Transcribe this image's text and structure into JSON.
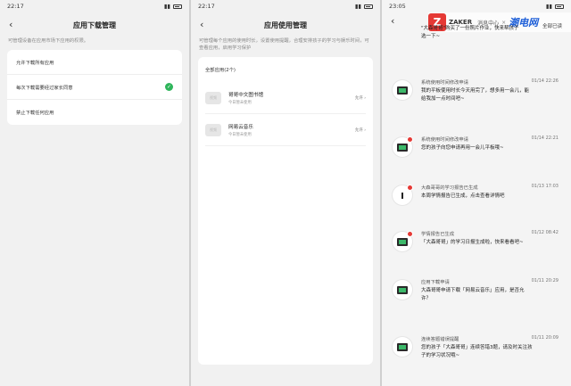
{
  "screen1": {
    "time": "22:17",
    "title": "应用下载管理",
    "hint": "可管理设备在应用市场下应用的权限。",
    "options": [
      {
        "label": "允许下载所有应用",
        "checked": false
      },
      {
        "label": "每次下载需要经过家长同意",
        "checked": true
      },
      {
        "label": "禁止下载任何应用",
        "checked": false
      }
    ]
  },
  "screen2": {
    "time": "22:17",
    "title": "应用使用管理",
    "hint": "可管理每个应用的使用时长，设置使用提醒，合理安排孩子的学习与娱乐时间，可查看应用，启用学习保护",
    "section": "全部应用(2个)",
    "apps": [
      {
        "icon_text": "视频",
        "name": "哥哥中文图书馆",
        "sub": "今日暂未使用",
        "right": "允许"
      },
      {
        "icon_text": "视频",
        "name": "网易云音乐",
        "sub": "今日暂未使用",
        "right": "允许"
      }
    ]
  },
  "screen3": {
    "time": "23:05",
    "read_all": "全部已读",
    "banner": {
      "logo": "Z",
      "brand": "ZAKER",
      "label": "消息中心",
      "sep": "×",
      "partner": "潮电网"
    },
    "top_message": "\"大森哥哥\"购买了一份照片作业，快来帮孩子\n选一下~",
    "messages": [
      {
        "title": "系统使用时间修改申请",
        "time": "01/14 22:26",
        "body": "我的平板使用时长今天用完了，想多用一会儿，能\n给我加一点时间吧~",
        "dot": false,
        "icon": "tablet"
      },
      {
        "title": "系统使用时间修改申请",
        "time": "01/14 22:21",
        "body": "您的孩子向您申请再用一会儿平板哦~",
        "dot": true,
        "icon": "tablet"
      },
      {
        "title": "大森哥哥的学习报告已生成",
        "time": "01/13 17:03",
        "body": "本周学情报告已生成，点击查看详情吧",
        "dot": true,
        "icon": "clock"
      },
      {
        "title": "学情报告已生成",
        "time": "01/12 08:42",
        "body": "「大森哥哥」的学习日报生成啦，快来看看吧~",
        "dot": true,
        "icon": "tablet"
      },
      {
        "title": "应用下载申请",
        "time": "01/11 20:29",
        "body": "大森哥哥申请下载「网易云音乐」应用，是否允\n许？",
        "dot": false,
        "icon": "tablet"
      },
      {
        "title": "连续答题错误提醒",
        "time": "01/11 20:09",
        "body": "您的孩子「大森哥哥」连续答错3题，请及时关注孩\n子的学习状况哦~",
        "dot": false,
        "icon": "tablet"
      }
    ]
  },
  "colors": {
    "accent": "#2fb55b",
    "badge": "#e53935",
    "brand_red": "#e53935",
    "brand_blue": "#1e5fd8"
  }
}
